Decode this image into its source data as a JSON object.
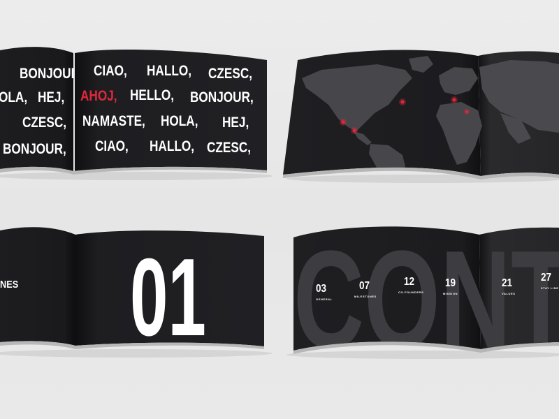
{
  "colors": {
    "background": "#e8e8e8",
    "page_dark": "#1c1c1e",
    "page_mid": "#26262a",
    "accent": "#e0283c",
    "text": "#ffffff",
    "map_land": "#444448",
    "big_letters": "#3c3c40"
  },
  "brochure_greetings": {
    "rows": [
      [
        "BONJOUR,",
        "CIAO,",
        "HALLO,",
        "CZESC,"
      ],
      [
        "OLA,",
        "HEJ,",
        "AHOJ,",
        "HELLO,",
        "BONJOUR,"
      ],
      [
        "CZESC,",
        "NAMASTE,",
        "HOLA,",
        "HEJ,"
      ],
      [
        "BONJOUR,",
        "CIAO,",
        "HALLO,",
        "CZESC,"
      ]
    ],
    "highlight_word": "AHOJ"
  },
  "brochure_map": {
    "markers": [
      "marker-1",
      "marker-2",
      "marker-3",
      "marker-4",
      "marker-5"
    ]
  },
  "brochure_chapter": {
    "number": "01",
    "left_fragment": "NES"
  },
  "brochure_contents": {
    "big_word": "CONTEN",
    "entries": [
      {
        "page": "03",
        "label": "GENERAL"
      },
      {
        "page": "07",
        "label": "MILESTONES"
      },
      {
        "page": "12",
        "label": "CO-FOUNDERS"
      },
      {
        "page": "19",
        "label": "MISSION"
      },
      {
        "page": "21",
        "label": "VALUES"
      },
      {
        "page": "27",
        "label": "STAY LINE"
      }
    ]
  }
}
